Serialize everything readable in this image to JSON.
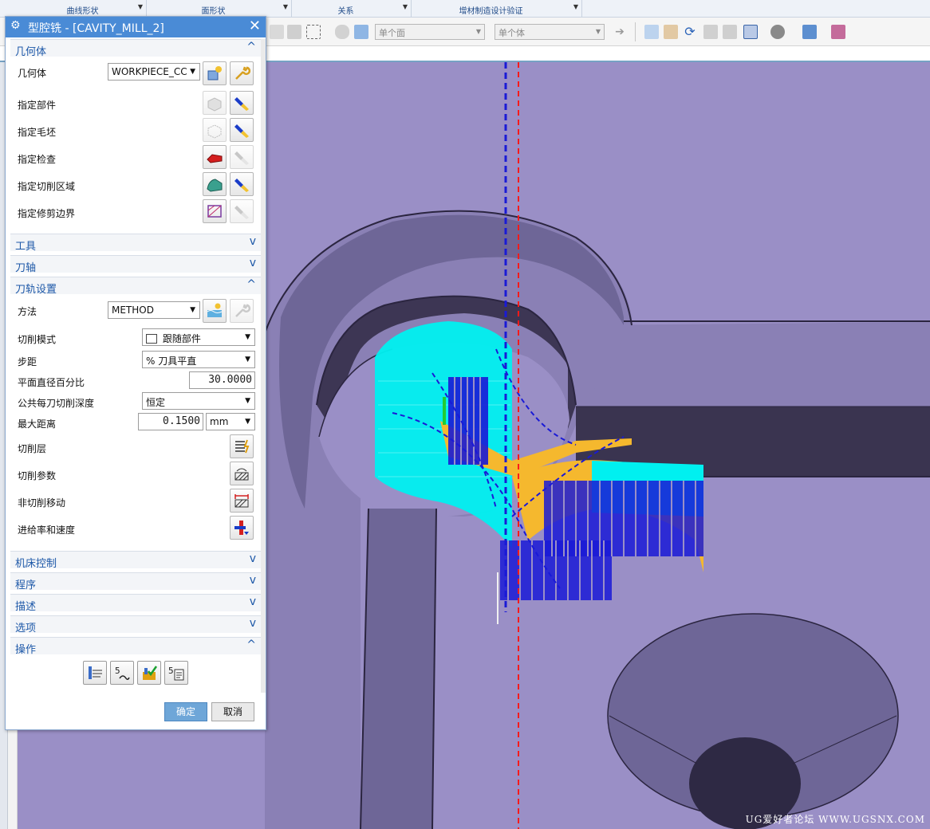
{
  "menu_groups": [
    {
      "label": "曲线形状"
    },
    {
      "label": "面形状"
    },
    {
      "label": "关系"
    },
    {
      "label": "增材制造设计验证"
    }
  ],
  "toolbar": {
    "face_filter": "单个面",
    "body_filter": "单个体"
  },
  "dialog": {
    "title": "型腔铣 - [CAVITY_MILL_2]",
    "sections": {
      "geometry": "几何体",
      "tool": "工具",
      "tool_axis": "刀轴",
      "path_settings": "刀轨设置",
      "machine_control": "机床控制",
      "program": "程序",
      "description": "描述",
      "options": "选项",
      "actions": "操作"
    },
    "geometry": {
      "label": "几何体",
      "value": "WORKPIECE_CC",
      "specify_part": "指定部件",
      "specify_blank": "指定毛坯",
      "specify_check": "指定检查",
      "specify_cut_area": "指定切削区域",
      "specify_trim_boundary": "指定修剪边界"
    },
    "path": {
      "method_label": "方法",
      "method_value": "METHOD",
      "cut_pattern_label": "切削模式",
      "cut_pattern_value": "跟随部件",
      "stepover_label": "步距",
      "stepover_value": "% 刀具平直",
      "percent_flat_label": "平面直径百分比",
      "percent_flat_value": "30.0000",
      "common_depth_label": "公共每刀切削深度",
      "common_depth_value": "恒定",
      "max_distance_label": "最大距离",
      "max_distance_value": "0.1500",
      "max_distance_unit": "mm",
      "cut_levels": "切削层",
      "cut_params": "切削参数",
      "non_cutting_moves": "非切削移动",
      "feeds_speeds": "进给率和速度"
    },
    "ok": "确定",
    "cancel": "取消"
  },
  "watermark": "UG爱好者论坛 WWW.UGSNX.COM",
  "colors": {
    "viewport_bg": "#9a8fc6",
    "title_bar": "#4a8bd6",
    "section_text": "#1d58a8",
    "toolpath_cyan": "#00f0f0",
    "toolpath_yellow": "#f5b82e",
    "toolpath_blue": "#1a1ad6",
    "axis_red": "#ff1a1a"
  }
}
